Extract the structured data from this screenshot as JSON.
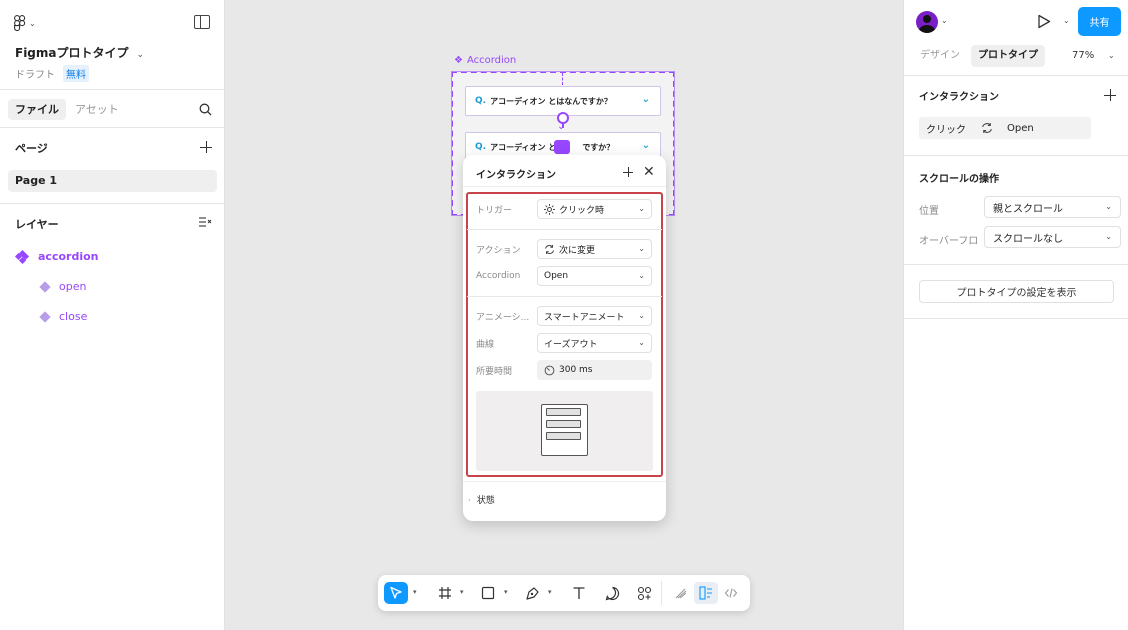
{
  "left": {
    "file_title": "Figmaプロトタイプ",
    "chevron": "⌄",
    "draft": "ドラフト",
    "free": "無料",
    "tabs": {
      "file": "ファイル",
      "assets": "アセット"
    },
    "pages_title": "ページ",
    "page_item": "Page 1",
    "layers_title": "レイヤー",
    "layers": [
      {
        "name": "accordion"
      },
      {
        "name": "open"
      },
      {
        "name": "close"
      }
    ]
  },
  "canvas": {
    "frame_label": "Accordion",
    "accordion_item_text": "アコーディオン とはなんですか？",
    "accordion_item_text_partial": "アコーディオン と",
    "accordion_item_text_tail": "ですか？",
    "q": "Q."
  },
  "popup": {
    "title": "インタラクション",
    "close": "✕",
    "trigger_label": "トリガー",
    "trigger_value": "クリック時",
    "action_label": "アクション",
    "action_value": "次に変更",
    "accordion_label": "Accordion",
    "accordion_value": "Open",
    "animation_label": "アニメーシ...",
    "animation_value": "スマートアニメート",
    "curve_label": "曲線",
    "curve_value": "イーズアウト",
    "duration_label": "所要時間",
    "duration_value": "300 ms",
    "state_label": "状態",
    "state_tri": "›"
  },
  "right": {
    "share": "共有",
    "tab_design": "デザイン",
    "tab_proto": "プロトタイプ",
    "zoom": "77%",
    "interaction_title": "インタラクション",
    "interaction_trigger": "クリック",
    "interaction_target": "Open",
    "scroll_title": "スクロールの操作",
    "position_label": "位置",
    "position_value": "親とスクロール",
    "overflow_label": "オーバーフロ",
    "overflow_value": "スクロールなし",
    "proto_settings": "プロトタイプの設定を表示"
  },
  "colors": {
    "accent": "#0d99ff",
    "component": "#9747ff",
    "highlight": "#c8434a"
  }
}
